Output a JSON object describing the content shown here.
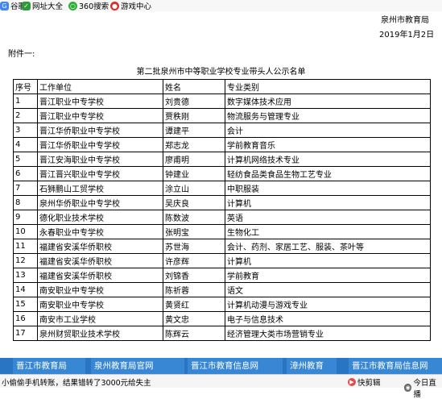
{
  "bookmarks": [
    {
      "icon": "google-icon",
      "label": "谷歌"
    },
    {
      "icon": "url-directory-icon",
      "label": "网址大全"
    },
    {
      "icon": "360-search-icon",
      "label": "360搜索"
    },
    {
      "icon": "game-center-icon",
      "label": "游戏中心"
    }
  ],
  "document": {
    "org": "泉州市教育局",
    "date": "2019年1月2日",
    "attachment": "附件一:",
    "title": "第二批泉州市中等职业学校专业带头人公示名单",
    "headers": [
      "序号",
      "工作单位",
      "姓名",
      "专业类别"
    ],
    "rows": [
      [
        "1",
        "晋江职业中专学校",
        "刘贵德",
        "数字媒体技术应用"
      ],
      [
        "2",
        "晋江职业中专学校",
        "贾秩刚",
        "物流服务与管理专业"
      ],
      [
        "3",
        "晋江华侨职业中专学校",
        "谭建平",
        "会计"
      ],
      [
        "4",
        "晋江华侨职业中专学校",
        "郑志龙",
        "学前教育音乐"
      ],
      [
        "5",
        "晋江安海职业中专学校",
        "廖甫明",
        "计算机网络技术专业"
      ],
      [
        "6",
        "晋江晋兴职业中专学校",
        "钟建业",
        "轻纺食品类食品生物工艺专业"
      ],
      [
        "7",
        "石狮鹏山工贸学校",
        "涂立山",
        "中职服装"
      ],
      [
        "8",
        "泉州华侨职业中专学校",
        "吴庆良",
        "计算机"
      ],
      [
        "9",
        "德化职业技术学校",
        "陈数波",
        "英语"
      ],
      [
        "10",
        "永春职业中专学校",
        "张明宝",
        "生物化工"
      ],
      [
        "11",
        "福建省安溪华侨职校",
        "苏世海",
        "会计、药剂、家居工艺、服装、茶叶等"
      ],
      [
        "12",
        "福建省安溪华侨职校",
        "许彦辉",
        "计算机"
      ],
      [
        "13",
        "福建省安溪华侨职校",
        "刘锦香",
        "学前教育"
      ],
      [
        "14",
        "南安职业中专学校",
        "陈祈蓉",
        "语文"
      ],
      [
        "15",
        "南安职业中专学校",
        "黄贤红",
        "计算机动漫与游戏专业"
      ],
      [
        "16",
        "南安市工业学校",
        "黄文忠",
        "电子与信息技术"
      ],
      [
        "17",
        "泉州财贸职业技术学校",
        "陈辉云",
        "经济管理大类市场营销专业"
      ]
    ]
  },
  "banner": [
    "晋江市教育局",
    "泉州教育局官网",
    "晋江市教育信息网",
    "漳州教育",
    "晋江市教育局信息网"
  ],
  "statusbar": {
    "news": "小偷偷手机转账，结果错转了3000元给失主",
    "items": [
      {
        "icon": "quick-clip-icon",
        "label": "快剪辑"
      },
      {
        "icon": "today-focus-icon",
        "label": "今日直播"
      }
    ]
  },
  "colors": {
    "banner_bg": "#2a74c4",
    "banner_item_bg": "#3787d4"
  }
}
